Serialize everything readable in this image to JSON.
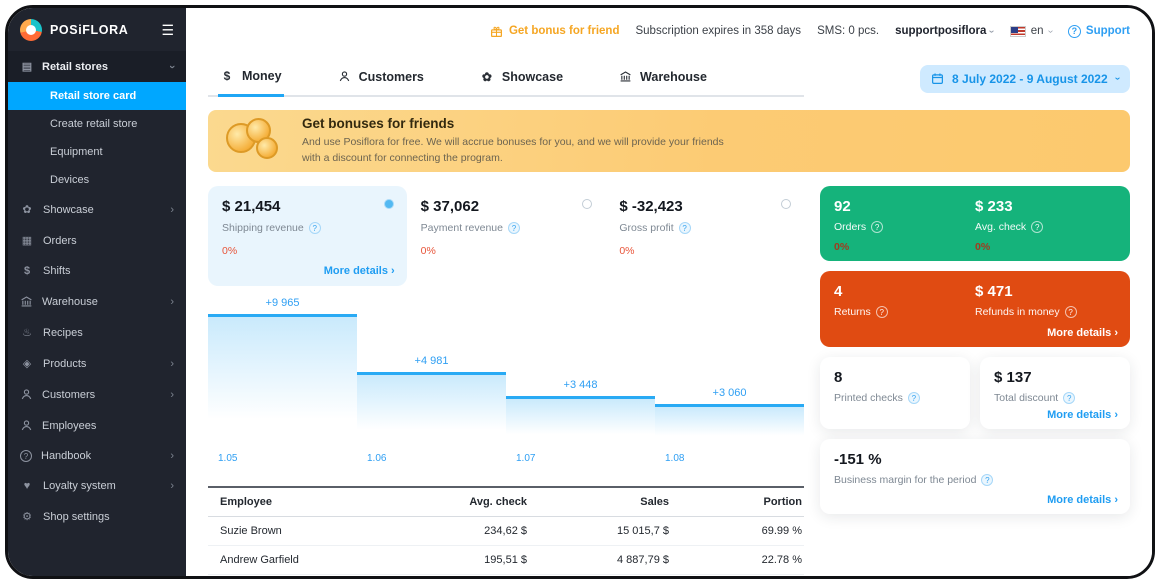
{
  "sidebar": {
    "logo": "POSiFLORA",
    "items": [
      {
        "label": "Retail stores"
      },
      {
        "label": "Retail store card"
      },
      {
        "label": "Create retail store"
      },
      {
        "label": "Equipment"
      },
      {
        "label": "Devices"
      },
      {
        "label": "Showcase"
      },
      {
        "label": "Orders"
      },
      {
        "label": "Shifts"
      },
      {
        "label": "Warehouse"
      },
      {
        "label": "Recipes"
      },
      {
        "label": "Products"
      },
      {
        "label": "Customers"
      },
      {
        "label": "Employees"
      },
      {
        "label": "Handbook"
      },
      {
        "label": "Loyalty system"
      },
      {
        "label": "Shop settings"
      }
    ]
  },
  "topbar": {
    "bonus": "Get bonus for friend",
    "subscription": "Subscription expires in 358 days",
    "sms": "SMS: 0 pcs.",
    "account": "supportposiflora",
    "language": "en",
    "support": "Support"
  },
  "tabs": {
    "items": [
      {
        "label": "Money"
      },
      {
        "label": "Customers"
      },
      {
        "label": "Showcase"
      },
      {
        "label": "Warehouse"
      }
    ],
    "date_range": "8 July 2022 - 9 August 2022"
  },
  "banner": {
    "title": "Get bonuses for friends",
    "text": "And use Posiflora for free. We will accrue bonuses for you, and we will provide your friends with a discount for connecting the program."
  },
  "ui": {
    "more": "More details"
  },
  "stats": [
    {
      "value": "$ 21,454",
      "label": "Shipping revenue",
      "percent": "0%"
    },
    {
      "value": "$ 37,062",
      "label": "Payment revenue",
      "percent": "0%"
    },
    {
      "value": "$ -32,423",
      "label": "Gross profit",
      "percent": "0%"
    }
  ],
  "side_cards": {
    "orders": {
      "value": "92",
      "label": "Orders",
      "percent": "0%"
    },
    "avg_check": {
      "value": "$ 233",
      "label": "Avg. check",
      "percent": "0%"
    },
    "returns": {
      "value": "4",
      "label": "Returns"
    },
    "refunds": {
      "value": "$ 471",
      "label": "Refunds in money"
    },
    "printed_checks": {
      "value": "8",
      "label": "Printed checks"
    },
    "total_discount": {
      "value": "$ 137",
      "label": "Total discount"
    },
    "margin": {
      "value": "-151 %",
      "label": "Business margin for the period"
    }
  },
  "chart_data": {
    "type": "area",
    "x": [
      "1.05",
      "1.06",
      "1.07",
      "1.08"
    ],
    "values": [
      9965,
      4981,
      3448,
      3060
    ],
    "labels": [
      "+9 965",
      "+4 981",
      "+3 448",
      "+3 060"
    ],
    "title": "",
    "xlabel": "",
    "ylabel": "",
    "ylim": [
      0,
      11000
    ],
    "grid": false,
    "legend": false
  },
  "table": {
    "headers": [
      "Employee",
      "Avg. check",
      "Sales",
      "Portion"
    ],
    "rows": [
      [
        "Suzie Brown",
        "234,62 $",
        "15 015,7 $",
        "69.99 %"
      ],
      [
        "Andrew Garfield",
        "195,51 $",
        "4 887,79 $",
        "22.78 %"
      ]
    ]
  }
}
